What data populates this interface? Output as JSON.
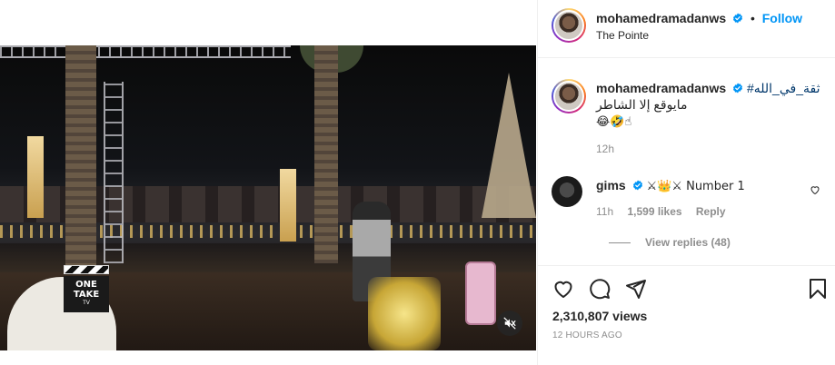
{
  "post": {
    "author": "mohamedramadanws",
    "follow_label": "Follow",
    "separator": "•",
    "location": "The Pointe",
    "caption": {
      "hashtag": "#ثقة_في_الله",
      "text": "مايوقع إلا الشاطر",
      "emojis": "😂🤣☝",
      "time": "12h"
    },
    "comment": {
      "author": "gims",
      "text": "⚔👑⚔ Number 1",
      "time": "11h",
      "likes": "1,599 likes",
      "reply_label": "Reply",
      "view_replies": "View replies (48)"
    },
    "views": "2,310,807 views",
    "date": "12 HOURS AGO"
  },
  "video": {
    "clapper_line1": "ONE",
    "clapper_line2": "TAKE",
    "clapper_line3": "TV"
  },
  "icons": {
    "verified": "verified-badge-icon",
    "like": "heart-icon",
    "comment": "comment-bubble-icon",
    "share": "paper-plane-icon",
    "save": "bookmark-icon",
    "mute": "muted-speaker-icon"
  },
  "colors": {
    "link_blue": "#0095f6",
    "hashtag": "#00376b",
    "muted_text": "#8e8e8e",
    "border": "#efefef"
  }
}
